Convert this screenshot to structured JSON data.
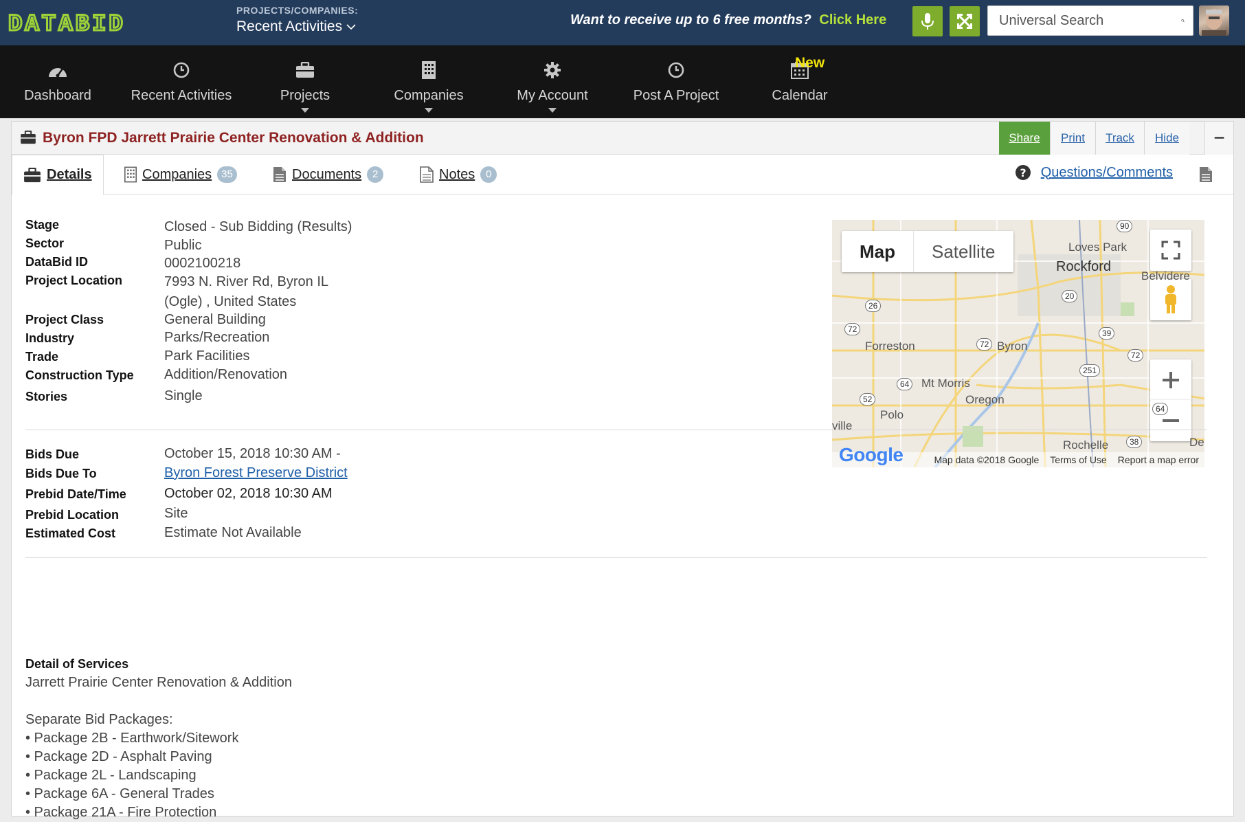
{
  "header": {
    "logo_text": "DATABID",
    "selector_label": "PROJECTS/COMPANIES:",
    "selector_value": "Recent Activities",
    "promo_text": "Want to receive up to 6 free months?",
    "promo_cta": "Click Here",
    "search_placeholder": "Universal Search"
  },
  "nav": {
    "items": [
      {
        "label": "Dashboard"
      },
      {
        "label": "Recent Activities"
      },
      {
        "label": "Projects"
      },
      {
        "label": "Companies"
      },
      {
        "label": "My Account"
      },
      {
        "label": "Post A Project"
      },
      {
        "label": "Calendar"
      }
    ],
    "new_badge": "New"
  },
  "project": {
    "title": "Byron FPD Jarrett Prairie Center Renovation & Addition",
    "actions": {
      "share": "Share",
      "print": "Print",
      "track": "Track",
      "hide": "Hide",
      "minimize": "−"
    }
  },
  "tabs": [
    {
      "label": "Details"
    },
    {
      "label": "Companies",
      "count": "35"
    },
    {
      "label": "Documents",
      "count": "2"
    },
    {
      "label": "Notes",
      "count": "0"
    }
  ],
  "questions_link": "Questions/Comments",
  "details": [
    {
      "key": "Stage",
      "value": "Closed - Sub Bidding (Results)"
    },
    {
      "key": "Sector",
      "value": "Public"
    },
    {
      "key": "DataBid ID",
      "value": "0002100218"
    },
    {
      "key": "Project Location",
      "value": "7993 N. River Rd,  Byron IL",
      "value2": "(Ogle) , United States"
    },
    {
      "key": "Project Class",
      "value": "General Building"
    },
    {
      "key": "Industry",
      "value": "Parks/Recreation"
    },
    {
      "key": "Trade",
      "value": "Park Facilities"
    },
    {
      "key": "Construction Type",
      "value": "Addition/Renovation"
    },
    {
      "key": "Stories",
      "value": "Single"
    }
  ],
  "bids": [
    {
      "key": "Bids Due",
      "value": "October 15, 2018 10:30 AM  -"
    },
    {
      "key": "Bids Due To",
      "value": "Byron Forest Preserve District"
    },
    {
      "key": "Prebid Date/Time",
      "value": "October 02, 2018 10:30 AM"
    },
    {
      "key": "Prebid Location",
      "value": "Site"
    },
    {
      "key": "Estimated Cost",
      "value": "Estimate Not Available"
    }
  ],
  "services": {
    "heading": "Detail of Services",
    "line1": "Jarrett Prairie Center Renovation & Addition",
    "packages_heading": "Separate Bid Packages:",
    "packages": [
      "• Package 2B - Earthwork/Sitework",
      "• Package 2D - Asphalt Paving",
      "• Package 2L - Landscaping",
      "• Package 6A - General Trades",
      "• Package 21A - Fire Protection"
    ]
  },
  "map": {
    "map_btn": "Map",
    "satellite_btn": "Satellite",
    "places": [
      "Loves Park",
      "Rockford",
      "Belvidere",
      "Forreston",
      "Byron",
      "Mt Morris",
      "Oregon",
      "Polo",
      "ville",
      "Rochelle",
      "DeK"
    ],
    "routes": [
      "90",
      "20",
      "26",
      "72",
      "39",
      "72",
      "72",
      "251",
      "64",
      "52",
      "64",
      "38"
    ],
    "google": "Google",
    "footer": [
      "Map data ©2018 Google",
      "Terms of Use",
      "Report a map error"
    ]
  }
}
